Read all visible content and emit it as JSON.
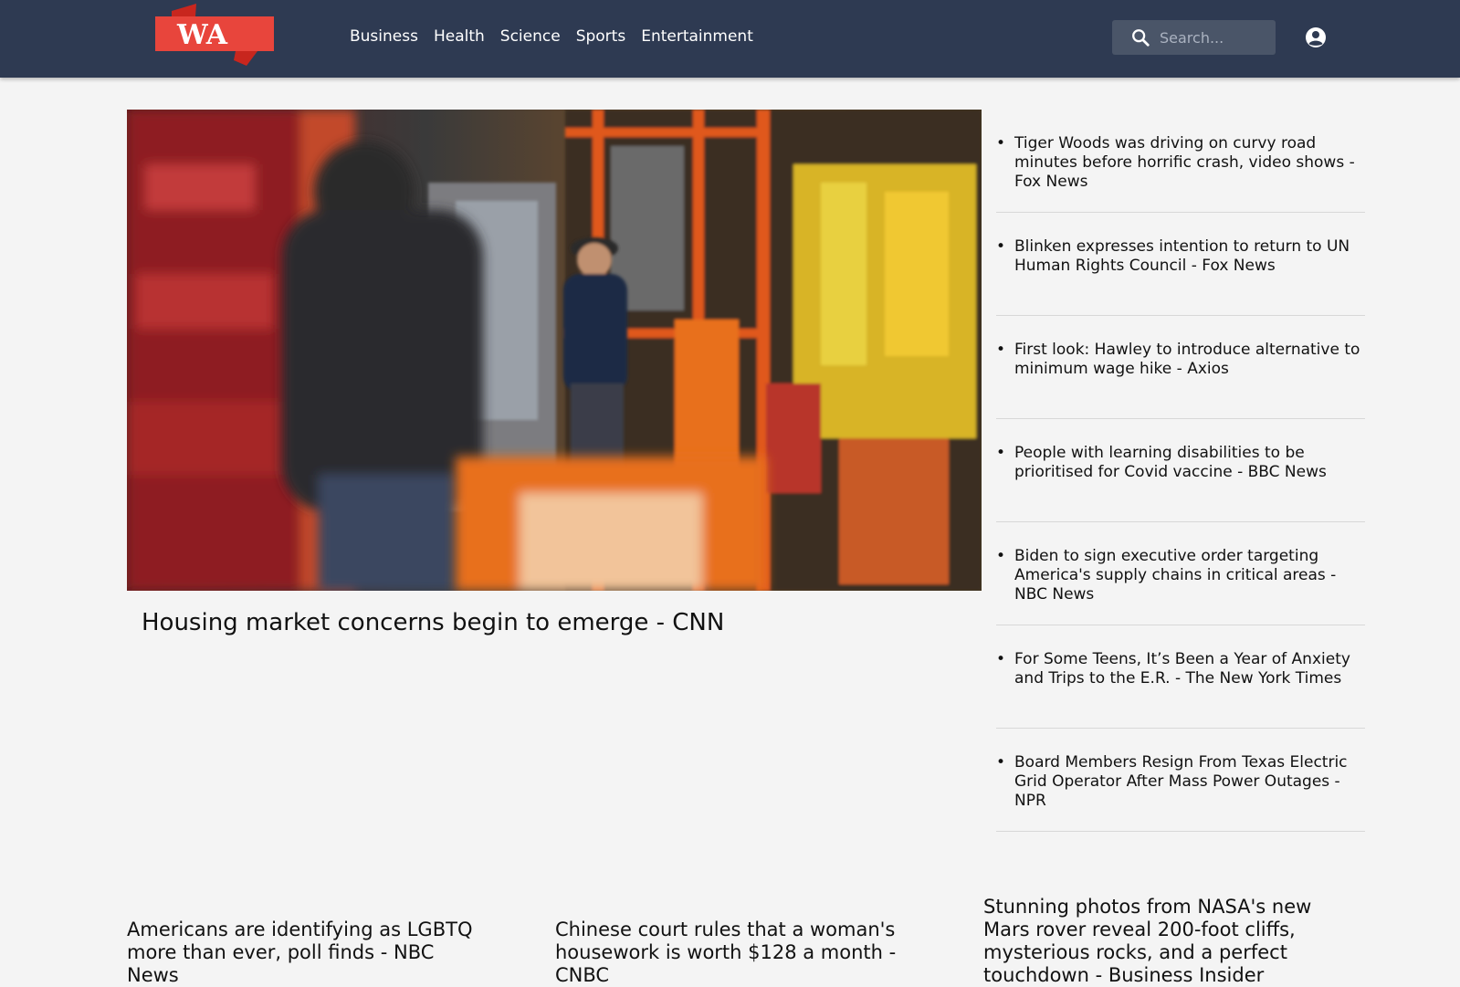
{
  "header": {
    "logo_text": "WA",
    "nav": [
      "Business",
      "Health",
      "Science",
      "Sports",
      "Entertainment"
    ],
    "search_placeholder": "Search..."
  },
  "hero": {
    "title": "Housing market concerns begin to emerge - CNN",
    "image_description_icon": "photo-store-aisle"
  },
  "sidebar_headlines": [
    "Tiger Woods was driving on curvy road minutes before horrific crash, video shows - Fox News",
    "Blinken expresses intention to return to UN Human Rights Council - Fox News",
    "First look: Hawley to introduce alternative to minimum wage hike - Axios",
    "People with learning disabilities to be prioritised for Covid vaccine - BBC News",
    "Biden to sign executive order targeting America's supply chains in critical areas - NBC News",
    "For Some Teens, It’s Been a Year of Anxiety and Trips to the E.R. - The New York Times",
    "Board Members Resign From Texas Electric Grid Operator After Mass Power Outages - NPR"
  ],
  "bottom_headlines": [
    "Americans are identifying as LGBTQ more than ever, poll finds - NBC News",
    "Chinese court rules that a woman's housework is worth $128 a month - CNBC",
    "Stunning photos from NASA's new Mars rover reveal 200-foot cliffs, mysterious rocks, and a perfect touchdown - Business Insider"
  ],
  "colors": {
    "header_bg": "#2e3a52",
    "logo_red": "#e8453c",
    "page_bg": "#f4f4f4"
  }
}
